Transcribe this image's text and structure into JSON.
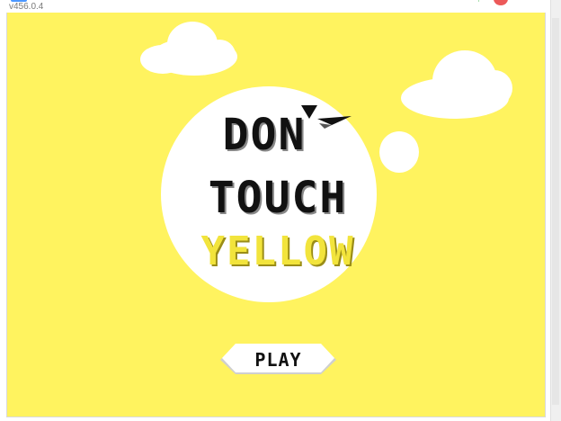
{
  "window": {
    "version": "v456.0.4"
  },
  "title": {
    "line1": "DON",
    "line2": "TOUCH",
    "line3": "YELLOW"
  },
  "buttons": {
    "play_label": "PLAY"
  },
  "colors": {
    "stage_background": "#fff35f",
    "yellow_text": "#f2e43c",
    "cloud": "#ffffff",
    "text_dark": "#111111"
  },
  "icons": {
    "top_left": "stage-icon",
    "green_flag": "green-flag-icon",
    "stop": "stop-icon",
    "plane": "paper-plane-icon"
  }
}
